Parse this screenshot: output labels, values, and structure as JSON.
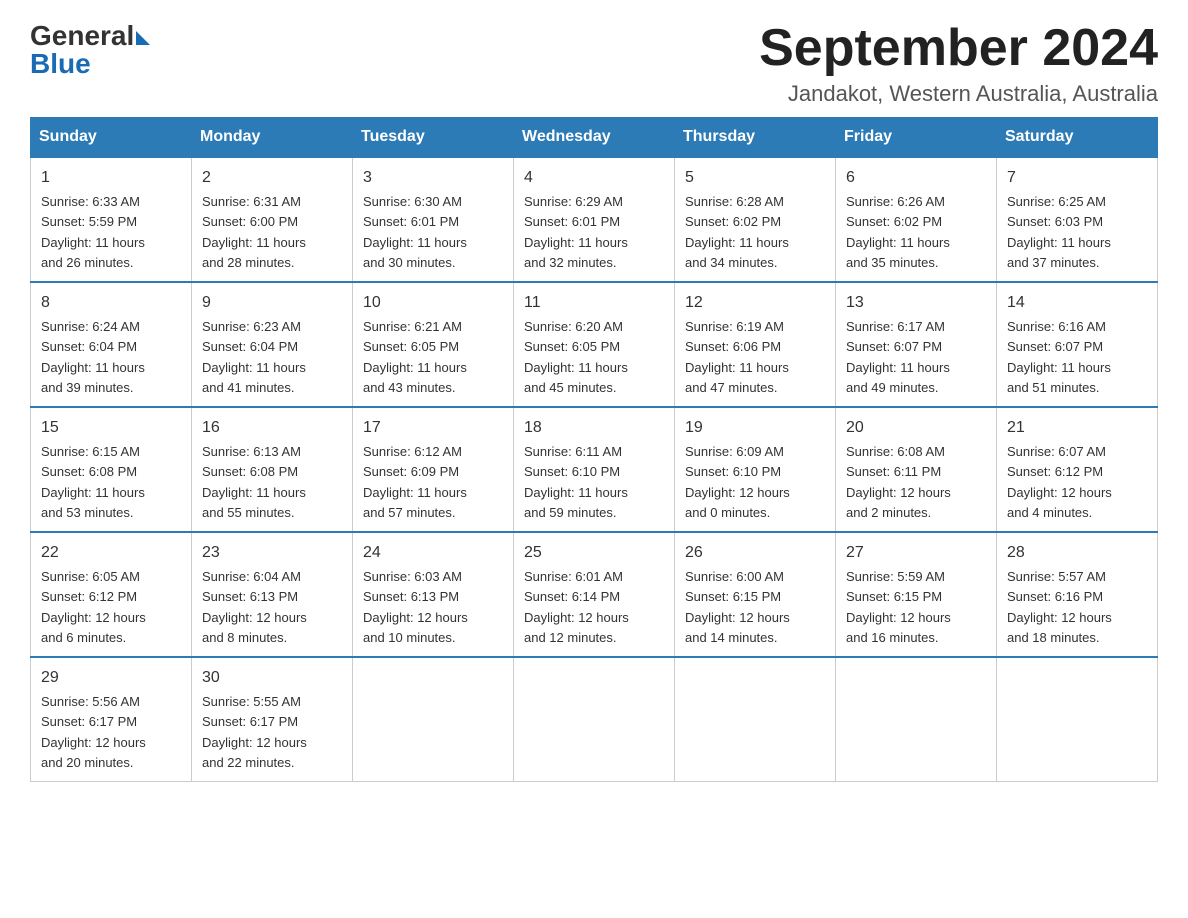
{
  "logo": {
    "general": "General",
    "blue": "Blue"
  },
  "header": {
    "month": "September 2024",
    "location": "Jandakot, Western Australia, Australia"
  },
  "days_of_week": [
    "Sunday",
    "Monday",
    "Tuesday",
    "Wednesday",
    "Thursday",
    "Friday",
    "Saturday"
  ],
  "weeks": [
    [
      {
        "day": "1",
        "sunrise": "6:33 AM",
        "sunset": "5:59 PM",
        "daylight": "11 hours and 26 minutes."
      },
      {
        "day": "2",
        "sunrise": "6:31 AM",
        "sunset": "6:00 PM",
        "daylight": "11 hours and 28 minutes."
      },
      {
        "day": "3",
        "sunrise": "6:30 AM",
        "sunset": "6:01 PM",
        "daylight": "11 hours and 30 minutes."
      },
      {
        "day": "4",
        "sunrise": "6:29 AM",
        "sunset": "6:01 PM",
        "daylight": "11 hours and 32 minutes."
      },
      {
        "day": "5",
        "sunrise": "6:28 AM",
        "sunset": "6:02 PM",
        "daylight": "11 hours and 34 minutes."
      },
      {
        "day": "6",
        "sunrise": "6:26 AM",
        "sunset": "6:02 PM",
        "daylight": "11 hours and 35 minutes."
      },
      {
        "day": "7",
        "sunrise": "6:25 AM",
        "sunset": "6:03 PM",
        "daylight": "11 hours and 37 minutes."
      }
    ],
    [
      {
        "day": "8",
        "sunrise": "6:24 AM",
        "sunset": "6:04 PM",
        "daylight": "11 hours and 39 minutes."
      },
      {
        "day": "9",
        "sunrise": "6:23 AM",
        "sunset": "6:04 PM",
        "daylight": "11 hours and 41 minutes."
      },
      {
        "day": "10",
        "sunrise": "6:21 AM",
        "sunset": "6:05 PM",
        "daylight": "11 hours and 43 minutes."
      },
      {
        "day": "11",
        "sunrise": "6:20 AM",
        "sunset": "6:05 PM",
        "daylight": "11 hours and 45 minutes."
      },
      {
        "day": "12",
        "sunrise": "6:19 AM",
        "sunset": "6:06 PM",
        "daylight": "11 hours and 47 minutes."
      },
      {
        "day": "13",
        "sunrise": "6:17 AM",
        "sunset": "6:07 PM",
        "daylight": "11 hours and 49 minutes."
      },
      {
        "day": "14",
        "sunrise": "6:16 AM",
        "sunset": "6:07 PM",
        "daylight": "11 hours and 51 minutes."
      }
    ],
    [
      {
        "day": "15",
        "sunrise": "6:15 AM",
        "sunset": "6:08 PM",
        "daylight": "11 hours and 53 minutes."
      },
      {
        "day": "16",
        "sunrise": "6:13 AM",
        "sunset": "6:08 PM",
        "daylight": "11 hours and 55 minutes."
      },
      {
        "day": "17",
        "sunrise": "6:12 AM",
        "sunset": "6:09 PM",
        "daylight": "11 hours and 57 minutes."
      },
      {
        "day": "18",
        "sunrise": "6:11 AM",
        "sunset": "6:10 PM",
        "daylight": "11 hours and 59 minutes."
      },
      {
        "day": "19",
        "sunrise": "6:09 AM",
        "sunset": "6:10 PM",
        "daylight": "12 hours and 0 minutes."
      },
      {
        "day": "20",
        "sunrise": "6:08 AM",
        "sunset": "6:11 PM",
        "daylight": "12 hours and 2 minutes."
      },
      {
        "day": "21",
        "sunrise": "6:07 AM",
        "sunset": "6:12 PM",
        "daylight": "12 hours and 4 minutes."
      }
    ],
    [
      {
        "day": "22",
        "sunrise": "6:05 AM",
        "sunset": "6:12 PM",
        "daylight": "12 hours and 6 minutes."
      },
      {
        "day": "23",
        "sunrise": "6:04 AM",
        "sunset": "6:13 PM",
        "daylight": "12 hours and 8 minutes."
      },
      {
        "day": "24",
        "sunrise": "6:03 AM",
        "sunset": "6:13 PM",
        "daylight": "12 hours and 10 minutes."
      },
      {
        "day": "25",
        "sunrise": "6:01 AM",
        "sunset": "6:14 PM",
        "daylight": "12 hours and 12 minutes."
      },
      {
        "day": "26",
        "sunrise": "6:00 AM",
        "sunset": "6:15 PM",
        "daylight": "12 hours and 14 minutes."
      },
      {
        "day": "27",
        "sunrise": "5:59 AM",
        "sunset": "6:15 PM",
        "daylight": "12 hours and 16 minutes."
      },
      {
        "day": "28",
        "sunrise": "5:57 AM",
        "sunset": "6:16 PM",
        "daylight": "12 hours and 18 minutes."
      }
    ],
    [
      {
        "day": "29",
        "sunrise": "5:56 AM",
        "sunset": "6:17 PM",
        "daylight": "12 hours and 20 minutes."
      },
      {
        "day": "30",
        "sunrise": "5:55 AM",
        "sunset": "6:17 PM",
        "daylight": "12 hours and 22 minutes."
      },
      null,
      null,
      null,
      null,
      null
    ]
  ],
  "labels": {
    "sunrise": "Sunrise:",
    "sunset": "Sunset:",
    "daylight": "Daylight:"
  }
}
